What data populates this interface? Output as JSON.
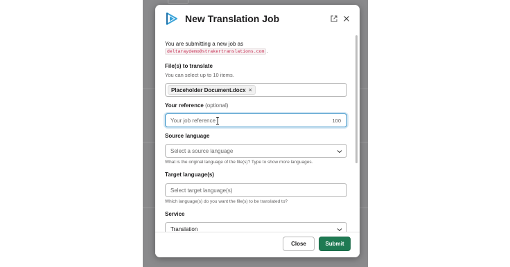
{
  "colors": {
    "accent": "#1f7a53",
    "focus": "#3a93c8",
    "logo": "#3aa3d8",
    "code_text": "#c5284d"
  },
  "modal": {
    "title": "New Translation Job",
    "popout_icon": "external-link-icon",
    "close_icon": "close-icon",
    "logo_icon": "play-logo-icon"
  },
  "intro": {
    "text": "You are submitting a new job as",
    "email": "deltaraydemo@strakertranslations.com",
    "email_suffix": "."
  },
  "files": {
    "label": "File(s) to translate",
    "hint": "You can select up to 10 items.",
    "chip": "Placeholder Document.docx",
    "chip_remove": "×"
  },
  "reference": {
    "label": "Your reference",
    "optional": "(optional)",
    "placeholder": "Your job reference",
    "counter": "100"
  },
  "source": {
    "label": "Source language",
    "placeholder": "Select a source language",
    "help": "What is the original language of the file(s)? Type to show more languages."
  },
  "target": {
    "label": "Target language(s)",
    "placeholder": "Select target language(s)",
    "help": "Which language(s) do you want the file(s) to be translated to?"
  },
  "service": {
    "label": "Service",
    "value": "Translation"
  },
  "footer": {
    "close_label": "Close",
    "submit_label": "Submit"
  }
}
